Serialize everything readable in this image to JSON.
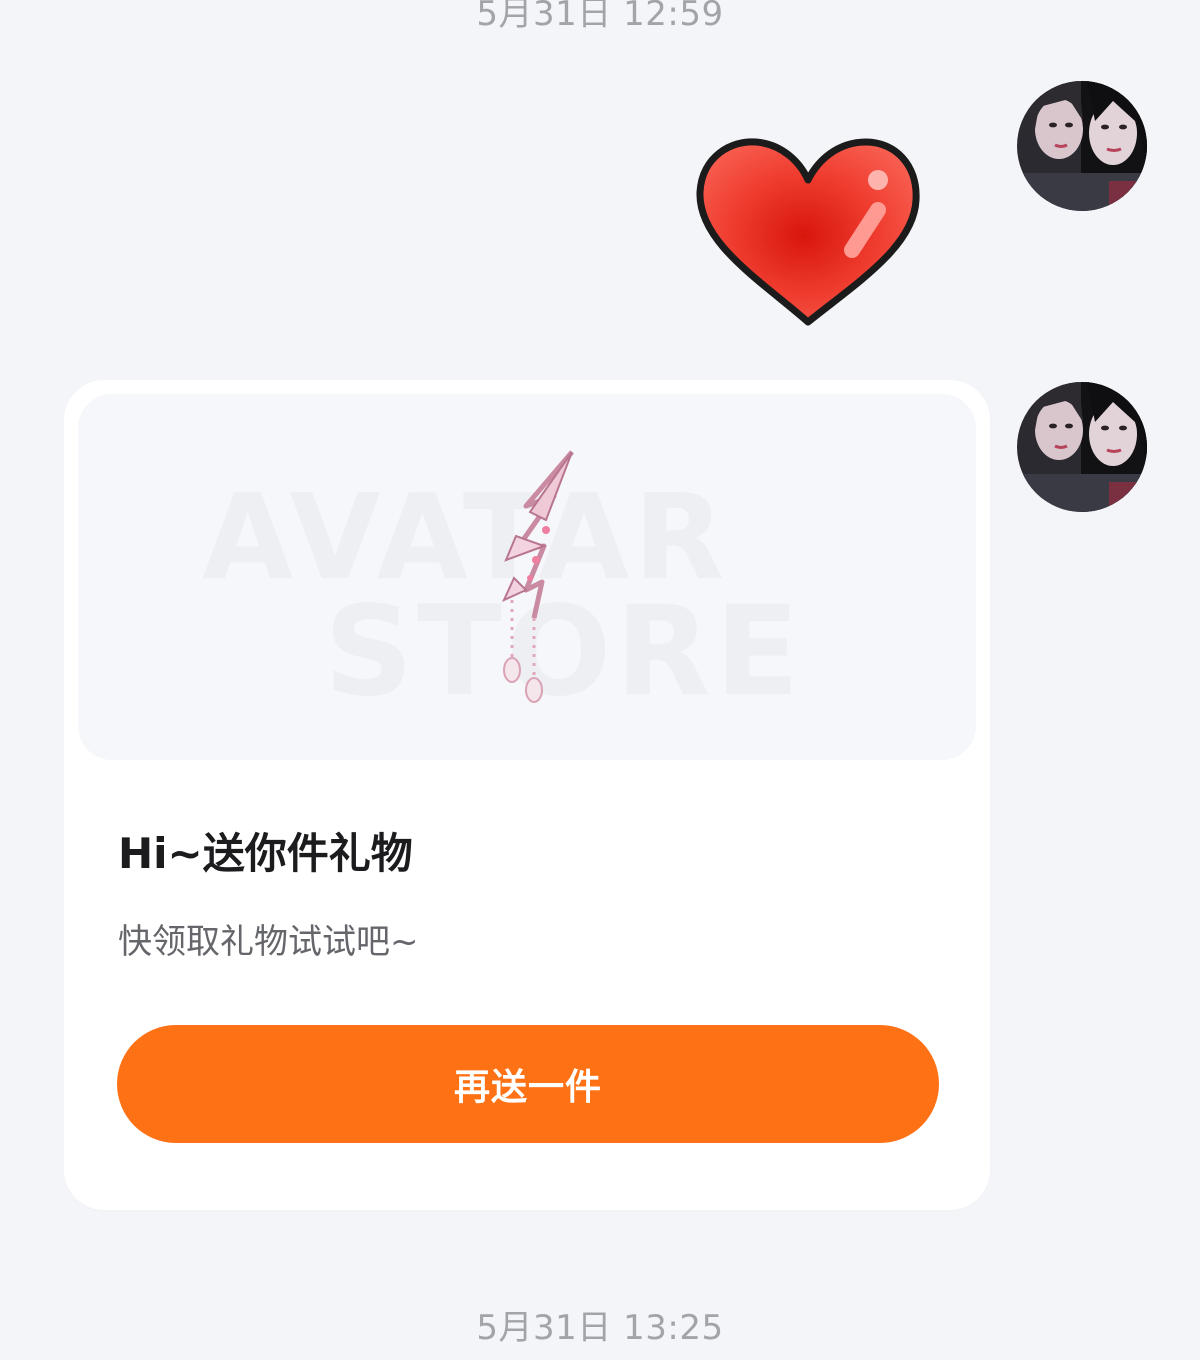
{
  "messages": {
    "timestamp_top": "5月31日 12:59",
    "timestamp_bottom": "5月31日 13:25"
  },
  "sticker": {
    "icon": "heart-icon",
    "color": "#f0453a"
  },
  "gift_card": {
    "watermark_line1": "AVATAR",
    "watermark_line2": "STORE",
    "title": "Hi~送你件礼物",
    "subtitle": "快领取礼物试试吧~",
    "button_label": "再送一件",
    "button_color": "#fe7215"
  }
}
